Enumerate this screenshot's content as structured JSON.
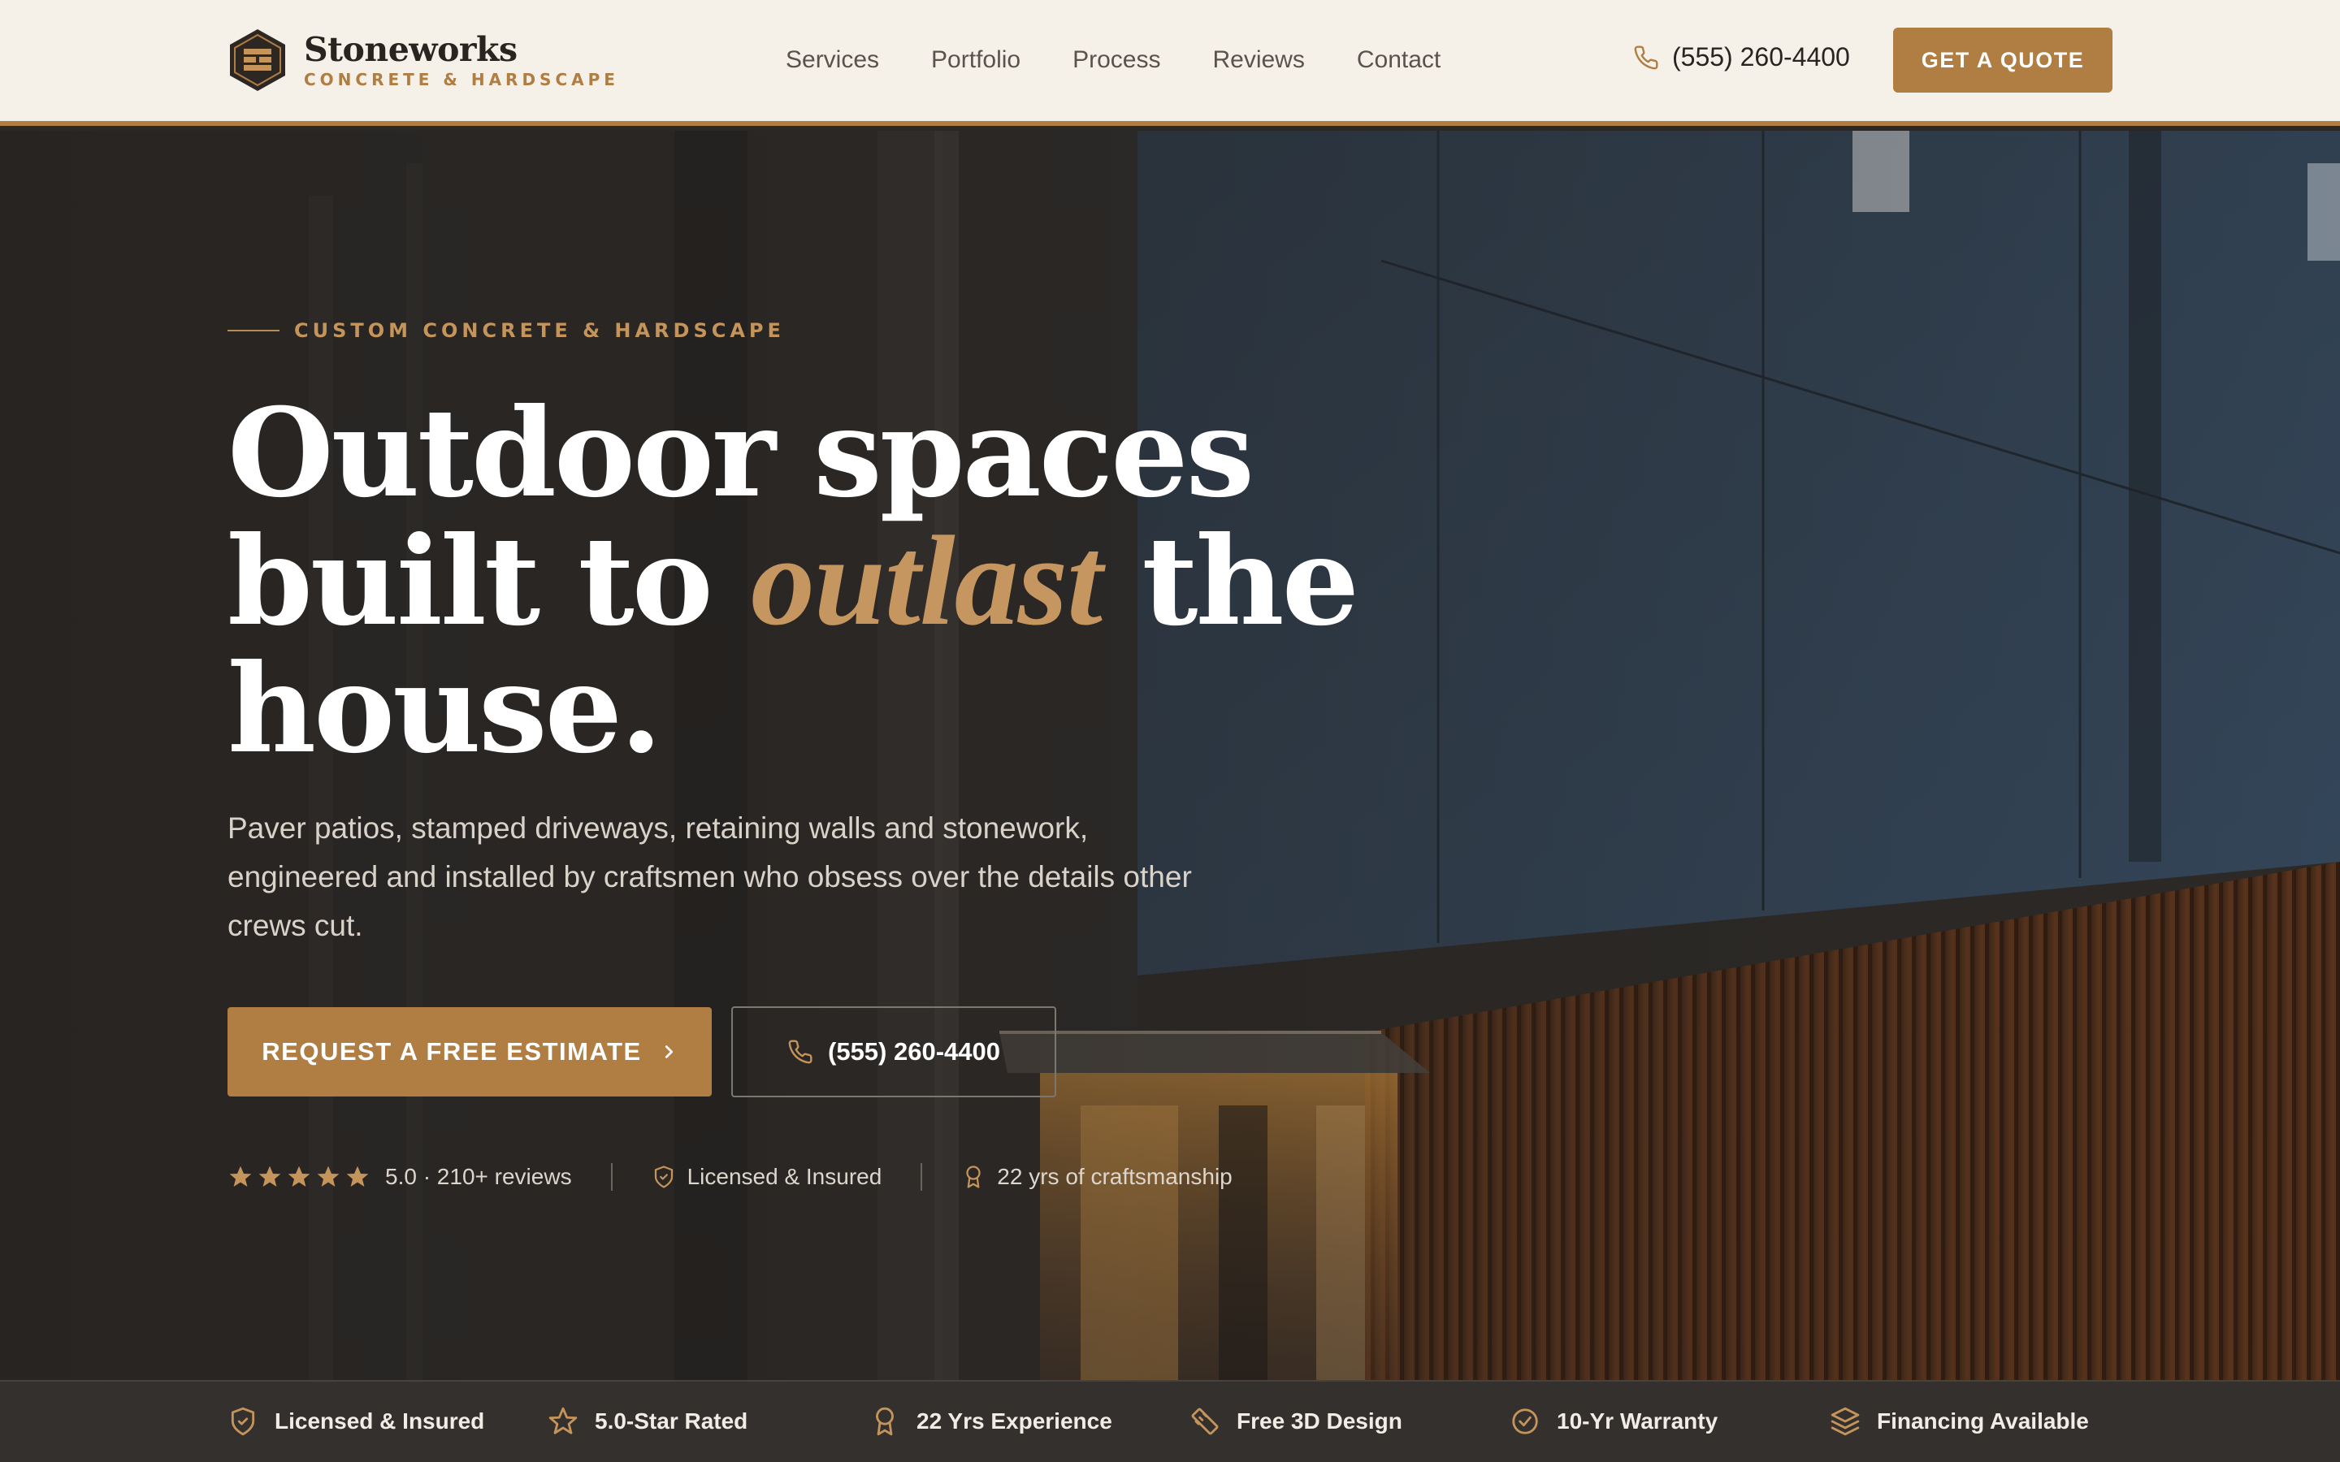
{
  "brand": {
    "name": "Stoneworks",
    "tagline": "CONCRETE & HARDSCAPE",
    "accent_color": "#b07d43",
    "header_bg": "#f5f0e8"
  },
  "nav": {
    "items": [
      "Services",
      "Portfolio",
      "Process",
      "Reviews",
      "Contact"
    ]
  },
  "header": {
    "phone": "(555) 260-4400",
    "quote_label": "GET A QUOTE"
  },
  "hero": {
    "eyebrow": "CUSTOM CONCRETE & HARDSCAPE",
    "headline_part1": "Outdoor spaces built to ",
    "headline_accent": "outlast",
    "headline_part2": " the house.",
    "subtext": "Paver patios, stamped driveways, retaining walls and stonework, engineered and installed by craftsmen who obsess over the details other crews cut.",
    "cta_primary": "REQUEST A FREE ESTIMATE",
    "cta_phone": "(555) 260-4400",
    "rating_stars": 5,
    "rating_text": "5.0 · 210+ reviews",
    "licensed_text": "Licensed & Insured",
    "experience_text": "22 yrs of craftsmanship"
  },
  "features": [
    {
      "icon": "shield-check-icon",
      "label": "Licensed & Insured"
    },
    {
      "icon": "star-icon",
      "label": "5.0-Star Rated"
    },
    {
      "icon": "award-icon",
      "label": "22 Yrs Experience"
    },
    {
      "icon": "ruler-icon",
      "label": "Free 3D Design"
    },
    {
      "icon": "check-circle-icon",
      "label": "10-Yr Warranty"
    },
    {
      "icon": "layers-icon",
      "label": "Financing Available"
    }
  ]
}
